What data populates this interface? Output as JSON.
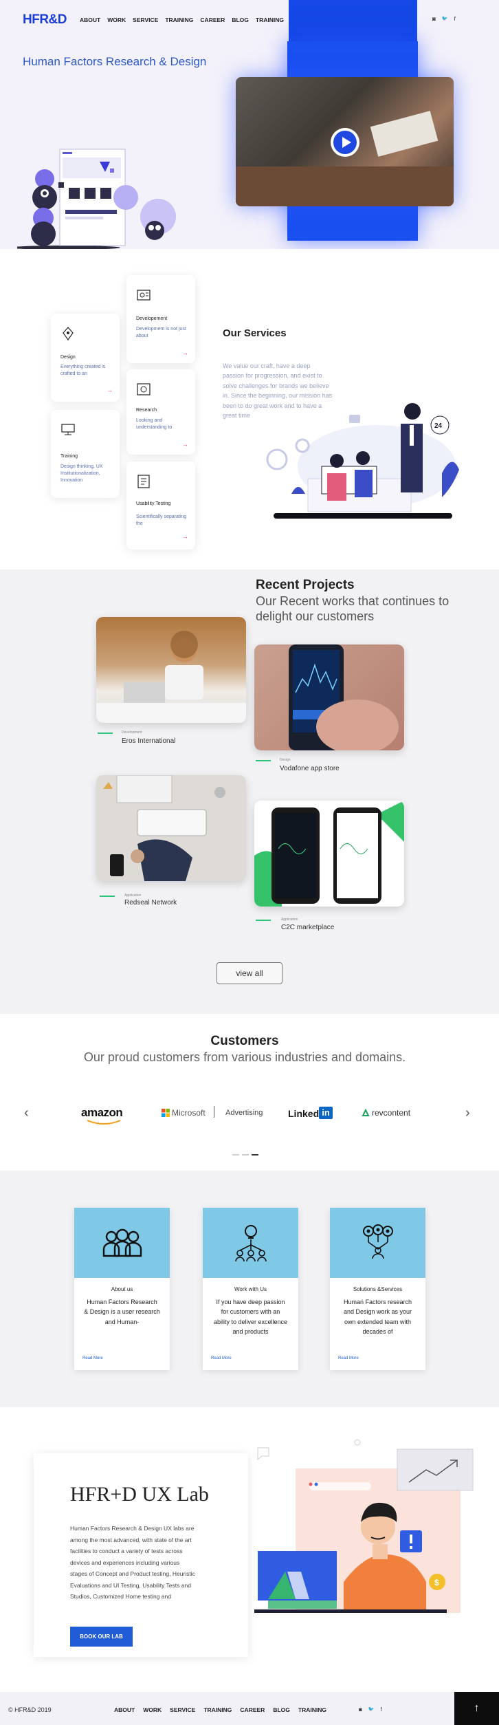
{
  "header": {
    "logo": "HFR&D",
    "nav": [
      "ABOUT",
      "WORK",
      "SERVICE",
      "TRAINING",
      "CAREER",
      "BLOG",
      "TRAINING"
    ],
    "social": [
      "instagram-icon",
      "twitter-icon",
      "facebook-icon"
    ],
    "social_glyphs": [
      "◙",
      "🐦",
      "f"
    ]
  },
  "hero": {
    "title": "Human Factors Research & Design",
    "accent_color": "#1548e6"
  },
  "services": {
    "title": "Our Services",
    "description": "We value our craft, have a deep passion for progression, and exist to solve challenges for brands we believe in. Since the beginning, our mission has been to do great work and to have a great time",
    "cards": [
      {
        "title": "Developement",
        "desc": "Development is not just about"
      },
      {
        "title": "Design",
        "desc": "Everything created is crafted to an"
      },
      {
        "title": "Research",
        "desc": "Looking and understanding to"
      },
      {
        "title": "Training",
        "desc": "Design thinking, UX Institutionalization, Innovation"
      },
      {
        "title": "Usability Testing",
        "desc": "Scientifically separating the"
      }
    ],
    "arrow": "→"
  },
  "projects": {
    "title": "Recent Projects",
    "subtitle": "Our Recent works that continues to delight our customers",
    "items": [
      {
        "category": "Development",
        "name": "Eros International"
      },
      {
        "category": "Design",
        "name": "Vodafone app store"
      },
      {
        "category": "Application",
        "name": "Redseal Network"
      },
      {
        "category": "Application",
        "name": "C2C marketplace"
      }
    ],
    "view_all": "view all"
  },
  "customers": {
    "title": "Customers",
    "subtitle": "Our proud customers from various industries and domains.",
    "logos": [
      "amazon",
      "Microsoft",
      "Advertising",
      "Linked",
      "in",
      "revcontent"
    ],
    "prev": "‹",
    "next": "›"
  },
  "about": {
    "cards": [
      {
        "title": "About us",
        "desc": "Human Factors Research & Design is a user research and Human-",
        "link": "Read More"
      },
      {
        "title": "Work with Us",
        "desc": "If you have deep passion for customers with an ability to deliver excellence and products",
        "link": "Read More"
      },
      {
        "title": "Solutions &Services",
        "desc": "Human Factors research and Design work as your own extended team with decades of",
        "link": "Read More"
      }
    ]
  },
  "lab": {
    "title": "HFR+D UX Lab",
    "description": "Human Factors Research & Design UX labs are among the most advanced, with state of the art facilities to conduct a variety of tests across devices and experiences including various stages of Concept and Product testing, Heuristic Evaluations and UI Testing, Usability Tests and Studios, Customized Home testing and",
    "button": "BOOK OUR LAB"
  },
  "footer": {
    "copyright": "© HFR&D 2019",
    "nav": [
      "ABOUT",
      "WORK",
      "SERVICE",
      "TRAINING",
      "CAREER",
      "BLOG",
      "TRAINING"
    ],
    "social_glyphs": [
      "◙",
      "🐦",
      "f"
    ],
    "to_top": "↑"
  }
}
